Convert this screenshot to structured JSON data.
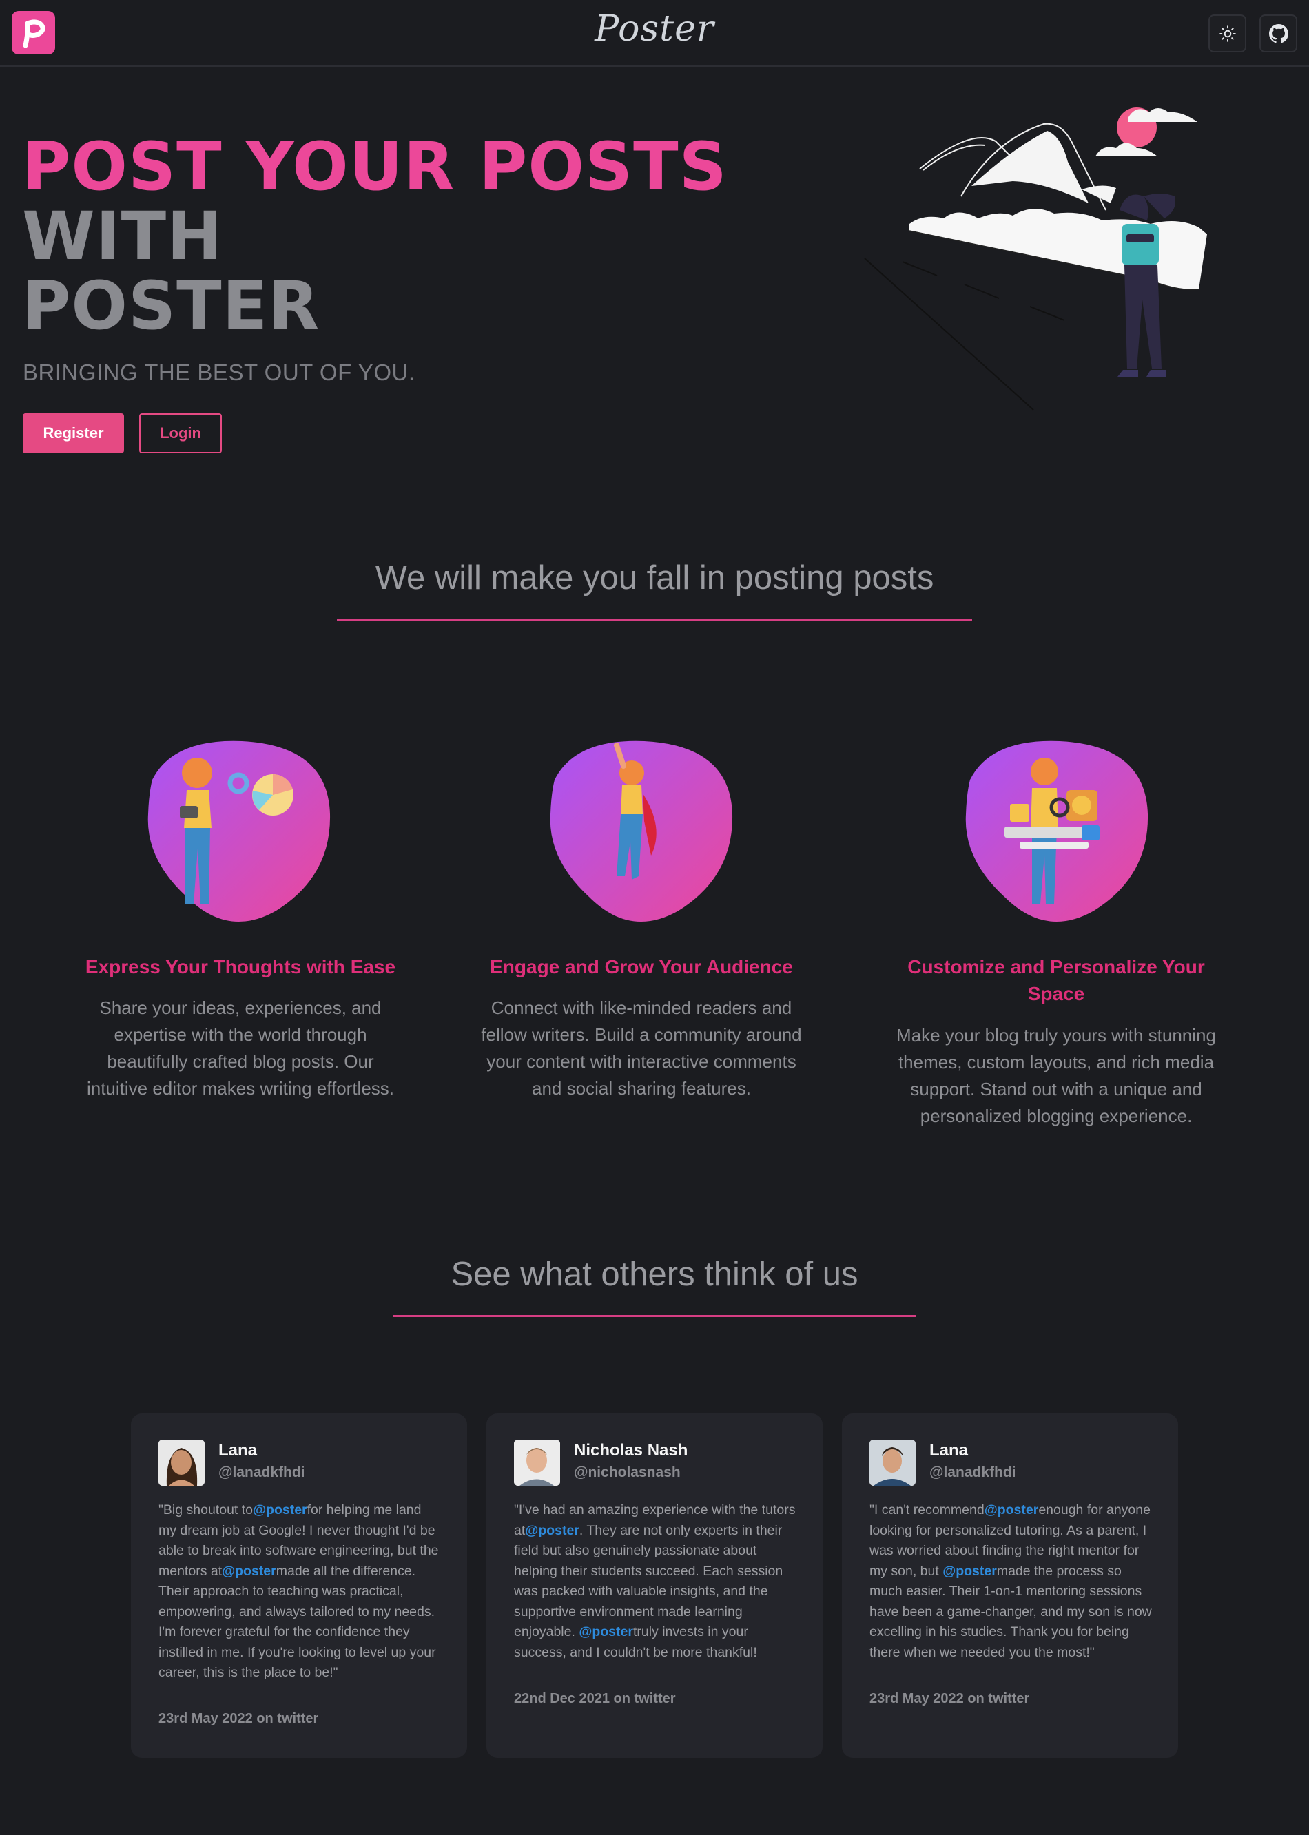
{
  "nav": {
    "brand": "Poster",
    "logo_icon": "p-logo-icon",
    "theme_icon": "sun-icon",
    "github_icon": "github-icon"
  },
  "hero": {
    "title_line1": "POST YOUR POSTS",
    "title_line2": "WITH",
    "title_line3": "POSTER",
    "subtitle": "BRINGING THE BEST OUT OF YOU.",
    "register_label": "Register",
    "login_label": "Login"
  },
  "features_section": {
    "heading": "We will make you fall in posting posts",
    "items": [
      {
        "title": "Express Your Thoughts with Ease",
        "description": "Share your ideas, experiences, and expertise with the world through beautifully crafted blog posts. Our intuitive editor makes writing effortless."
      },
      {
        "title": "Engage and Grow Your Audience",
        "description": "Connect with like-minded readers and fellow writers. Build a community around your content with interactive comments and social sharing features."
      },
      {
        "title": "Customize and Personalize Your Space",
        "description": "Make your blog truly yours with stunning themes, custom layouts, and rich media support. Stand out with a unique and personalized blogging experience."
      }
    ]
  },
  "testimonials_section": {
    "heading": "See what others think of us",
    "cards": [
      {
        "name": "Lana",
        "handle": "@lanadkfhdi",
        "q1": "\"Big shoutout to",
        "m1": "@poster",
        "q2": "for helping me land my dream job at Google! I never thought I'd be able to break into software engineering, but the mentors at",
        "m2": "@poster",
        "q3": "made all the difference. Their approach to teaching was practical, empowering, and always tailored to my needs. I'm forever grateful for the confidence they instilled in me. If you're looking to level up your career, this is the place to be!\"",
        "date": "23rd May 2022 on twitter"
      },
      {
        "name": "Nicholas Nash",
        "handle": "@nicholasnash",
        "q1": "\"I've had an amazing experience with the tutors at",
        "m1": "@poster",
        "q2": ". They are not only experts in their field but also genuinely passionate about helping their students succeed. Each session was packed with valuable insights, and the supportive environment made learning enjoyable. ",
        "m2": "@poster",
        "q3": "truly invests in your success, and I couldn't be more thankful!",
        "date": "22nd Dec 2021 on twitter"
      },
      {
        "name": "Lana",
        "handle": "@lanadkfhdi",
        "q1": "\"I can't recommend",
        "m1": "@poster",
        "q2": "enough for anyone looking for personalized tutoring. As a parent, I was worried about finding the right mentor for my son, but ",
        "m2": "@poster",
        "q3": "made the process so much easier. Their 1-on-1 mentoring sessions have been a game-changer, and my son is now excelling in his studies. Thank you for being there when we needed you the most!\"",
        "date": "23rd May 2022 on twitter"
      }
    ]
  },
  "colors": {
    "accent": "#ec4899",
    "background": "#1b1c20",
    "card": "#24252b",
    "mention": "#2e8bdc"
  }
}
